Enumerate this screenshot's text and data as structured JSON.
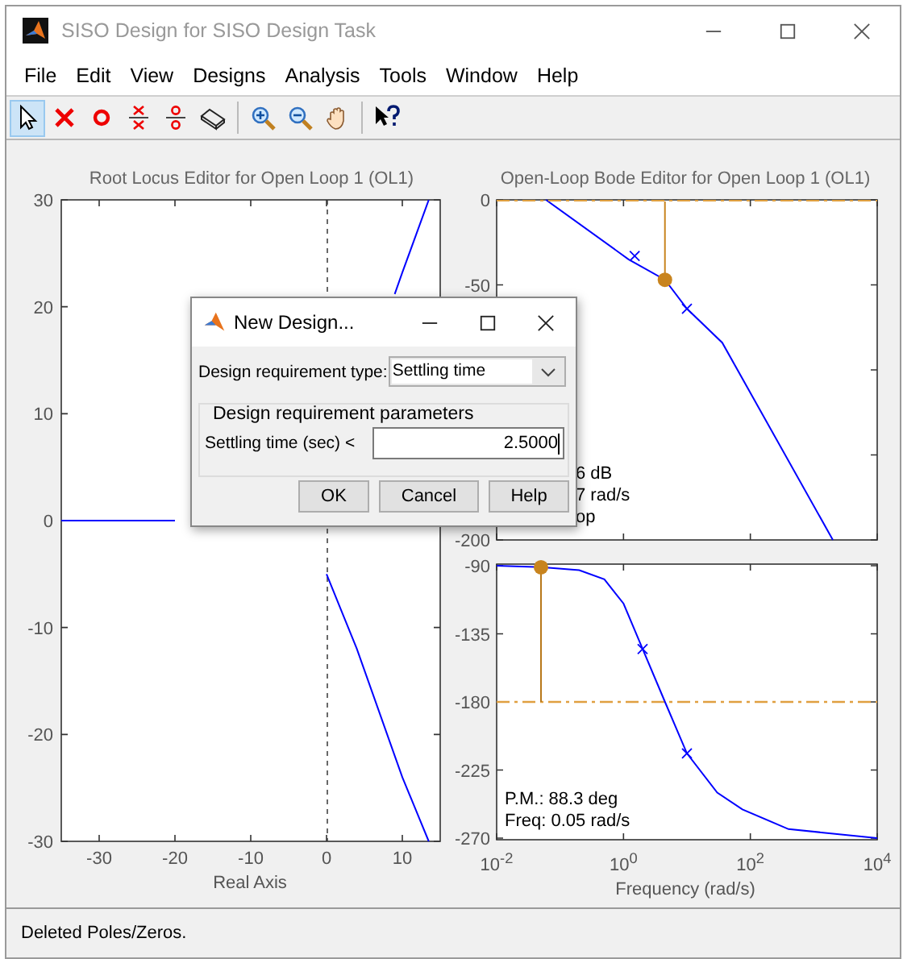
{
  "window": {
    "title": "SISO Design for SISO Design Task"
  },
  "menu": [
    "File",
    "Edit",
    "View",
    "Designs",
    "Analysis",
    "Tools",
    "Window",
    "Help"
  ],
  "toolbar": [
    {
      "kind": "pointer",
      "selected": true
    },
    {
      "kind": "pole",
      "selected": false
    },
    {
      "kind": "zero",
      "selected": false
    },
    {
      "kind": "pole-pair",
      "selected": false
    },
    {
      "kind": "zero-pair",
      "selected": false
    },
    {
      "kind": "eraser",
      "selected": false
    },
    {
      "kind": "zoom-in",
      "selected": false
    },
    {
      "kind": "zoom-out",
      "selected": false
    },
    {
      "kind": "pan",
      "selected": false
    },
    {
      "kind": "help",
      "selected": false
    }
  ],
  "root_locus": {
    "chart_data": {
      "type": "line",
      "title": "Root Locus Editor for Open Loop 1 (OL1)",
      "xlabel": "Real Axis",
      "x": [
        -35,
        -20,
        0,
        4,
        9,
        10,
        13.5
      ],
      "series": [
        {
          "color": "#0000ff",
          "values": [
            0,
            0,
            null,
            null,
            null,
            null,
            null
          ]
        },
        {
          "color": "#0000ff",
          "values": [
            null,
            null,
            null,
            null,
            21.2,
            23.2,
            30
          ]
        },
        {
          "color": "#0000ff",
          "values": [
            null,
            null,
            -5,
            -12,
            -22,
            -24,
            -30
          ]
        }
      ],
      "xlim": [
        -35,
        15
      ],
      "ylim": [
        -30,
        30
      ],
      "xticks": [
        -30,
        -20,
        -10,
        0,
        10
      ],
      "yticks": [
        30,
        20,
        10,
        0,
        -10,
        -20,
        -30
      ]
    }
  },
  "bode": {
    "title": "Open-Loop Bode Editor for Open Loop 1 (OL1)",
    "magnitude": {
      "y_tick_labels": [
        "0",
        "-50",
        "-200"
      ],
      "margin_text": [
        "6 dB",
        "7 rad/s",
        "op"
      ]
    },
    "phase": {
      "y_tick_labels": [
        "-90",
        "-135",
        "-180",
        "-225",
        "-270"
      ],
      "x_tick_labels": [
        "10$^{-2}$",
        "10$^{0}$",
        "10$^{2}$",
        "10$^{4}$"
      ],
      "x_label": "Frequency (rad/s)",
      "margin_text": [
        "P.M.: 88.3 deg",
        "Freq: 0.05 rad/s"
      ]
    }
  },
  "dialog": {
    "title": "New Design...",
    "type_label": "Design requirement type:",
    "type_value": "Settling time",
    "group_title": "Design requirement parameters",
    "param_label": "Settling time (sec) <",
    "param_value": "2.5000",
    "buttons": [
      "OK",
      "Cancel",
      "Help"
    ]
  },
  "status_bar": "Deleted Poles/Zeros."
}
